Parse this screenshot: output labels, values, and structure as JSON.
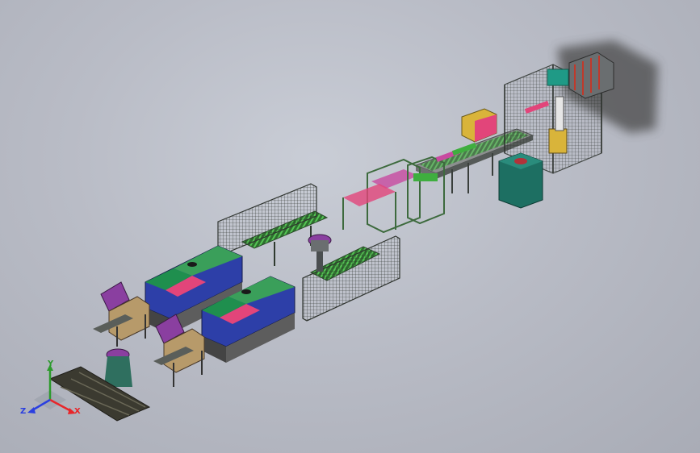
{
  "viewport": {
    "background_top": "#c9cdd6",
    "background_bottom": "#a9acb6"
  },
  "triad": {
    "x_label": "X",
    "y_label": "Y",
    "z_label": "Z",
    "x_color": "#e8262a",
    "y_color": "#2c9a2c",
    "z_color": "#2a3fe0"
  },
  "colors": {
    "frame": "#5a6a5a",
    "green_machine": "#1f8f4e",
    "blue_panel": "#2d3fa8",
    "pink_panel": "#e2457a",
    "teal_cabinet": "#1d6f62",
    "purple_hood": "#8a3fa0",
    "yellow_accent": "#d9b43a",
    "conveyor_green": "#3fae3f",
    "pallet": "#3b3a30"
  }
}
